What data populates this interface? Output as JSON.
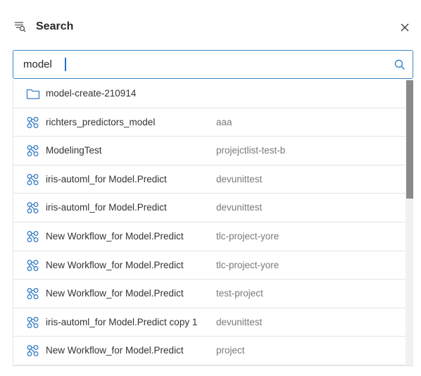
{
  "header": {
    "title": "Search",
    "filter_icon": "search-filter-icon",
    "close_icon": "close-icon"
  },
  "search": {
    "value": "model",
    "placeholder": "",
    "icon": "search-icon"
  },
  "colors": {
    "accent": "#3a86c8",
    "icon_blue": "#3a7fc7",
    "divider": "#e4e4e4",
    "secondary_text": "#7a7a7a"
  },
  "results": [
    {
      "type": "folder",
      "icon": "folder-icon",
      "name": "model-create-210914",
      "project": ""
    },
    {
      "type": "workflow",
      "icon": "workflow-icon",
      "name": "richters_predictors_model",
      "project": "aaa"
    },
    {
      "type": "workflow",
      "icon": "workflow-icon",
      "name": "ModelingTest",
      "project": "projejctlist-test-b"
    },
    {
      "type": "workflow",
      "icon": "workflow-icon",
      "name": "iris-automl_for Model.Predict",
      "project": "devunittest"
    },
    {
      "type": "workflow",
      "icon": "workflow-icon",
      "name": "iris-automl_for Model.Predict",
      "project": "devunittest"
    },
    {
      "type": "workflow",
      "icon": "workflow-icon",
      "name": "New Workflow_for Model.Predict",
      "project": "tlc-project-yore"
    },
    {
      "type": "workflow",
      "icon": "workflow-icon",
      "name": "New Workflow_for Model.Predict",
      "project": "tlc-project-yore"
    },
    {
      "type": "workflow",
      "icon": "workflow-icon",
      "name": "New Workflow_for Model.Predict",
      "project": "test-project"
    },
    {
      "type": "workflow",
      "icon": "workflow-icon",
      "name": "iris-automl_for Model.Predict copy 1",
      "project": "devunittest"
    },
    {
      "type": "workflow",
      "icon": "workflow-icon",
      "name": "New Workflow_for Model.Predict",
      "project": "project"
    }
  ]
}
